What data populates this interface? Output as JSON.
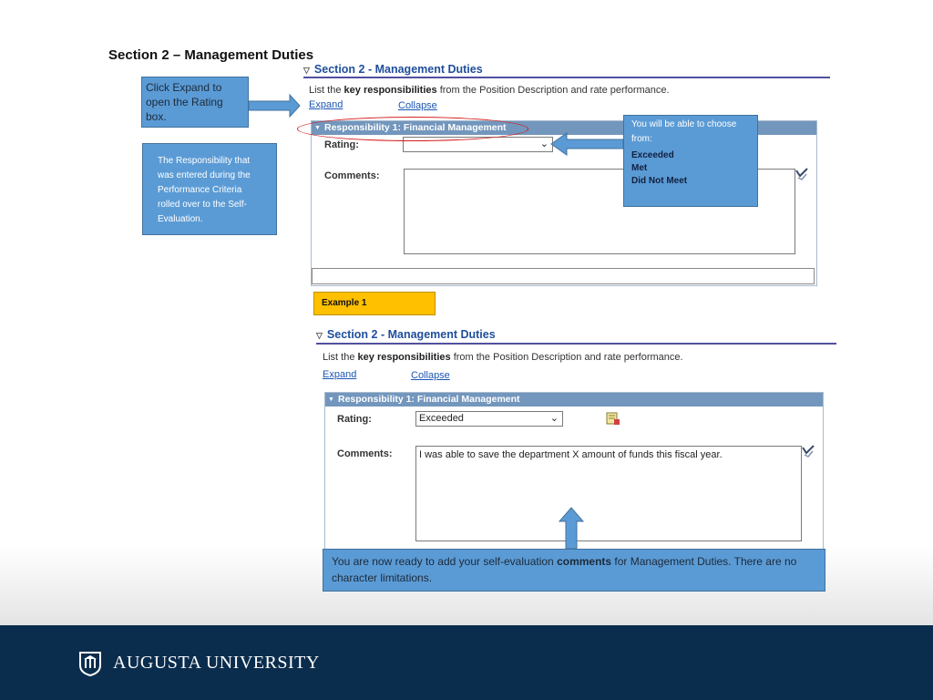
{
  "slide_title": "Section 2 – Management Duties",
  "callouts": {
    "expand_hint": "Click Expand to open the Rating box.",
    "responsibility_note": "The Responsibility that was entered during the Performance Criteria rolled over to the Self-Evaluation.",
    "choose_from": "You will be able to choose from:",
    "options": [
      "Exceeded",
      "Met",
      "Did Not Meet"
    ],
    "ready_before": "You are now ready to add your self-evaluation ",
    "ready_bold": "comments",
    "ready_after": " for Management Duties.  There are no character limitations."
  },
  "example_label": "Example 1",
  "screenshot1": {
    "section_title": "Section 2 - Management Duties",
    "instr_before": "List the ",
    "instr_bold": "key responsibilities",
    "instr_after": " from the Position Description and rate performance.",
    "expand": "Expand",
    "collapse": "Collapse",
    "panel_title": "Responsibility 1: Financial Management",
    "rating_label": "Rating:",
    "rating_value": "",
    "comments_label": "Comments:",
    "comments_value": ""
  },
  "screenshot2": {
    "section_title": "Section 2 - Management Duties",
    "instr_before": "List the ",
    "instr_bold": "key responsibilities",
    "instr_after": " from the Position Description and rate performance.",
    "expand": "Expand",
    "collapse": "Collapse",
    "panel_title": "Responsibility 1: Financial Management",
    "rating_label": "Rating:",
    "rating_value": "Exceeded",
    "comments_label": "Comments:",
    "comments_value": "I was able to save the department X amount of funds this fiscal year."
  },
  "footer": {
    "university": "AUGUSTA UNIVERSITY"
  },
  "colors": {
    "callout": "#5b9bd5",
    "example": "#ffc000",
    "footer": "#0b2d4d",
    "panel_header": "#7396bd"
  }
}
